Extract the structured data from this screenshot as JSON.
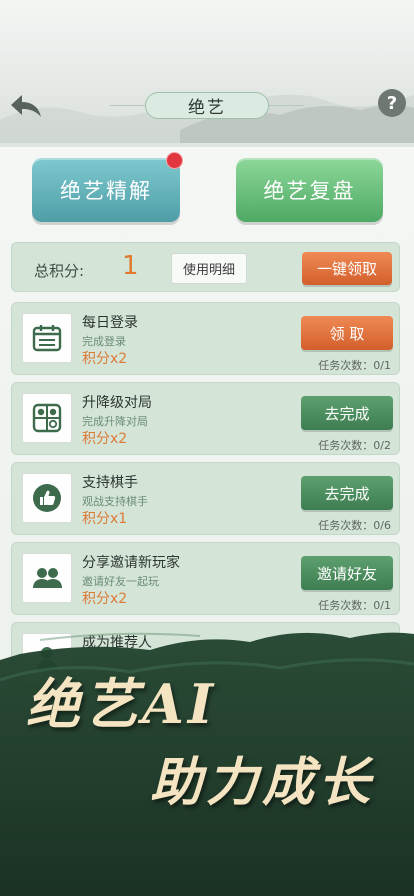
{
  "header": {
    "title": "绝艺"
  },
  "top_buttons": {
    "jiexi_label": "绝艺精解",
    "fupan_label": "绝艺复盘"
  },
  "points": {
    "label": "总积分:",
    "value": "1",
    "detail_label": "使用明细",
    "claim_all_label": "一键领取"
  },
  "tasks": [
    {
      "title": "每日登录",
      "subtitle": "完成登录",
      "reward": "积分x2",
      "button": "领 取",
      "count": "任务次数：0/1",
      "icon": "calendar-icon"
    },
    {
      "title": "升降级对局",
      "subtitle": "完成升降对局",
      "reward": "积分x2",
      "button": "去完成",
      "count": "任务次数：0/2",
      "icon": "go-board-icon"
    },
    {
      "title": "支持棋手",
      "subtitle": "观战支持棋手",
      "reward": "积分x1",
      "button": "去完成",
      "count": "任务次数：0/6",
      "icon": "thumbs-up-icon"
    },
    {
      "title": "分享邀请新玩家",
      "subtitle": "邀请好友一起玩",
      "reward": "积分x2",
      "button": "邀请好友",
      "count": "任务次数：0/1",
      "icon": "users-icon"
    },
    {
      "title": "成为推荐人",
      "icon": "user-icon"
    }
  ],
  "banner": {
    "line1": "绝艺AI",
    "line2": "助力成长"
  },
  "colors": {
    "accent_orange": "#d35f2b",
    "accent_green": "#3e7d51",
    "points_orange": "#e07a2e",
    "banner_dark": "#173325"
  }
}
